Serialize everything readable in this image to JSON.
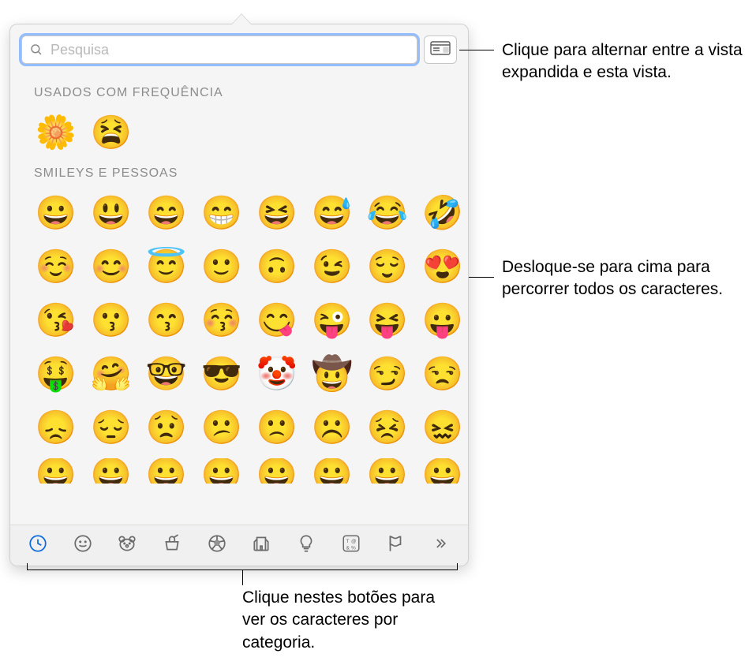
{
  "search": {
    "placeholder": "Pesquisa"
  },
  "sections": {
    "frequent": {
      "title": "USADOS COM FREQUÊNCIA",
      "items": [
        "🌼",
        "😫"
      ]
    },
    "smileys": {
      "title": "SMILEYS E PESSOAS",
      "rows": [
        [
          "😀",
          "😃",
          "😄",
          "😁",
          "😆",
          "😅",
          "😂",
          "🤣"
        ],
        [
          "☺️",
          "😊",
          "😇",
          "🙂",
          "🙃",
          "😉",
          "😌",
          "😍"
        ],
        [
          "😘",
          "😗",
          "😙",
          "😚",
          "😋",
          "😜",
          "😝",
          "😛"
        ],
        [
          "🤑",
          "🤗",
          "🤓",
          "😎",
          "🤡",
          "🤠",
          "😏",
          "😒"
        ],
        [
          "😞",
          "😔",
          "😟",
          "😕",
          "🙁",
          "☹️",
          "😣",
          "😖"
        ]
      ],
      "partial_row": [
        "😀",
        "😀",
        "😀",
        "😀",
        "😀",
        "😀",
        "😀",
        "😀"
      ]
    }
  },
  "categories": [
    {
      "id": "recent",
      "name": "clock-icon",
      "active": true
    },
    {
      "id": "smileys",
      "name": "smiley-icon"
    },
    {
      "id": "animals",
      "name": "bear-icon"
    },
    {
      "id": "food",
      "name": "food-icon"
    },
    {
      "id": "activity",
      "name": "soccer-icon"
    },
    {
      "id": "travel",
      "name": "building-icon"
    },
    {
      "id": "objects",
      "name": "lightbulb-icon"
    },
    {
      "id": "symbols",
      "name": "symbols-icon"
    },
    {
      "id": "flags",
      "name": "flag-icon"
    },
    {
      "id": "more",
      "name": "chevrons-right-icon"
    }
  ],
  "callouts": {
    "expand": "Clique para alternar entre a vista expandida e esta vista.",
    "scroll": "Desloque-se para cima para percorrer todos os caracteres.",
    "categories": "Clique nestes botões para ver os caracteres por categoria."
  }
}
